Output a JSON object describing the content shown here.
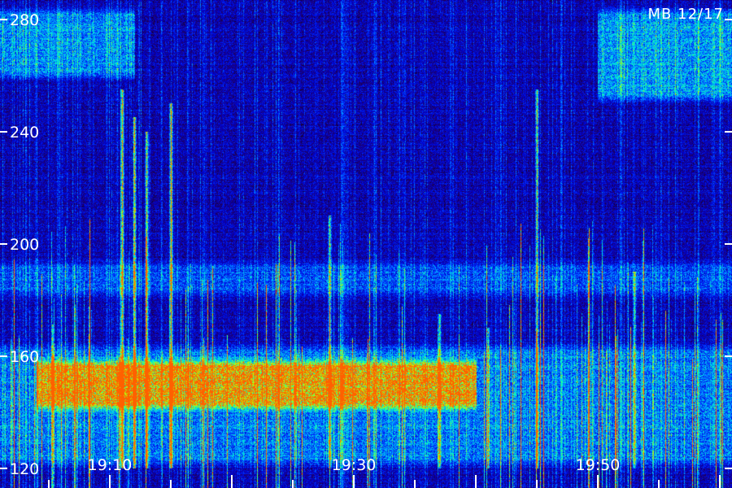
{
  "chart_data": {
    "type": "heatmap",
    "title": "",
    "xlabel": "",
    "ylabel": "",
    "corner_label": "MB 12/17",
    "x_unit": "time (HH:MM)",
    "xlim": [
      "19:01",
      "20:01"
    ],
    "ylim": [
      113,
      287
    ],
    "y_ticks": [
      120,
      160,
      200,
      240,
      280
    ],
    "x_major_ticks": [
      "19:10",
      "19:30",
      "19:50"
    ],
    "x_minor_tick_interval_minutes": 5,
    "colormap": [
      "#000000",
      "#20006a",
      "#0000c8",
      "#0030ff",
      "#00b0ff",
      "#00ffc0",
      "#c0ff00",
      "#ff6000"
    ],
    "bands": [
      {
        "y_range": [
          258,
          285
        ],
        "x_range": [
          "19:01",
          "19:12"
        ],
        "intensity": 0.5
      },
      {
        "y_range": [
          250,
          285
        ],
        "x_range": [
          "19:50",
          "20:01"
        ],
        "intensity": 0.55
      },
      {
        "y_range": [
          140,
          160
        ],
        "x_range": [
          "19:04",
          "19:40"
        ],
        "intensity": 0.85
      },
      {
        "y_range": [
          120,
          165
        ],
        "x_range": [
          "19:01",
          "20:01"
        ],
        "intensity": 0.45
      },
      {
        "y_range": [
          180,
          195
        ],
        "x_range": [
          "19:01",
          "20:01"
        ],
        "intensity": 0.35
      }
    ],
    "streaks": [
      {
        "x": "19:11",
        "y_range": [
          120,
          255
        ],
        "intensity": 0.95
      },
      {
        "x": "19:12",
        "y_range": [
          120,
          245
        ],
        "intensity": 0.9
      },
      {
        "x": "19:13",
        "y_range": [
          120,
          240
        ],
        "intensity": 0.8
      },
      {
        "x": "19:15",
        "y_range": [
          120,
          250
        ],
        "intensity": 1.0
      },
      {
        "x": "19:28",
        "y_range": [
          120,
          210
        ],
        "intensity": 0.7
      },
      {
        "x": "19:37",
        "y_range": [
          120,
          175
        ],
        "intensity": 0.6
      },
      {
        "x": "19:41",
        "y_range": [
          120,
          170
        ],
        "intensity": 0.55
      },
      {
        "x": "19:45",
        "y_range": [
          120,
          255
        ],
        "intensity": 0.75
      },
      {
        "x": "19:53",
        "y_range": [
          120,
          190
        ],
        "intensity": 0.5
      }
    ]
  }
}
